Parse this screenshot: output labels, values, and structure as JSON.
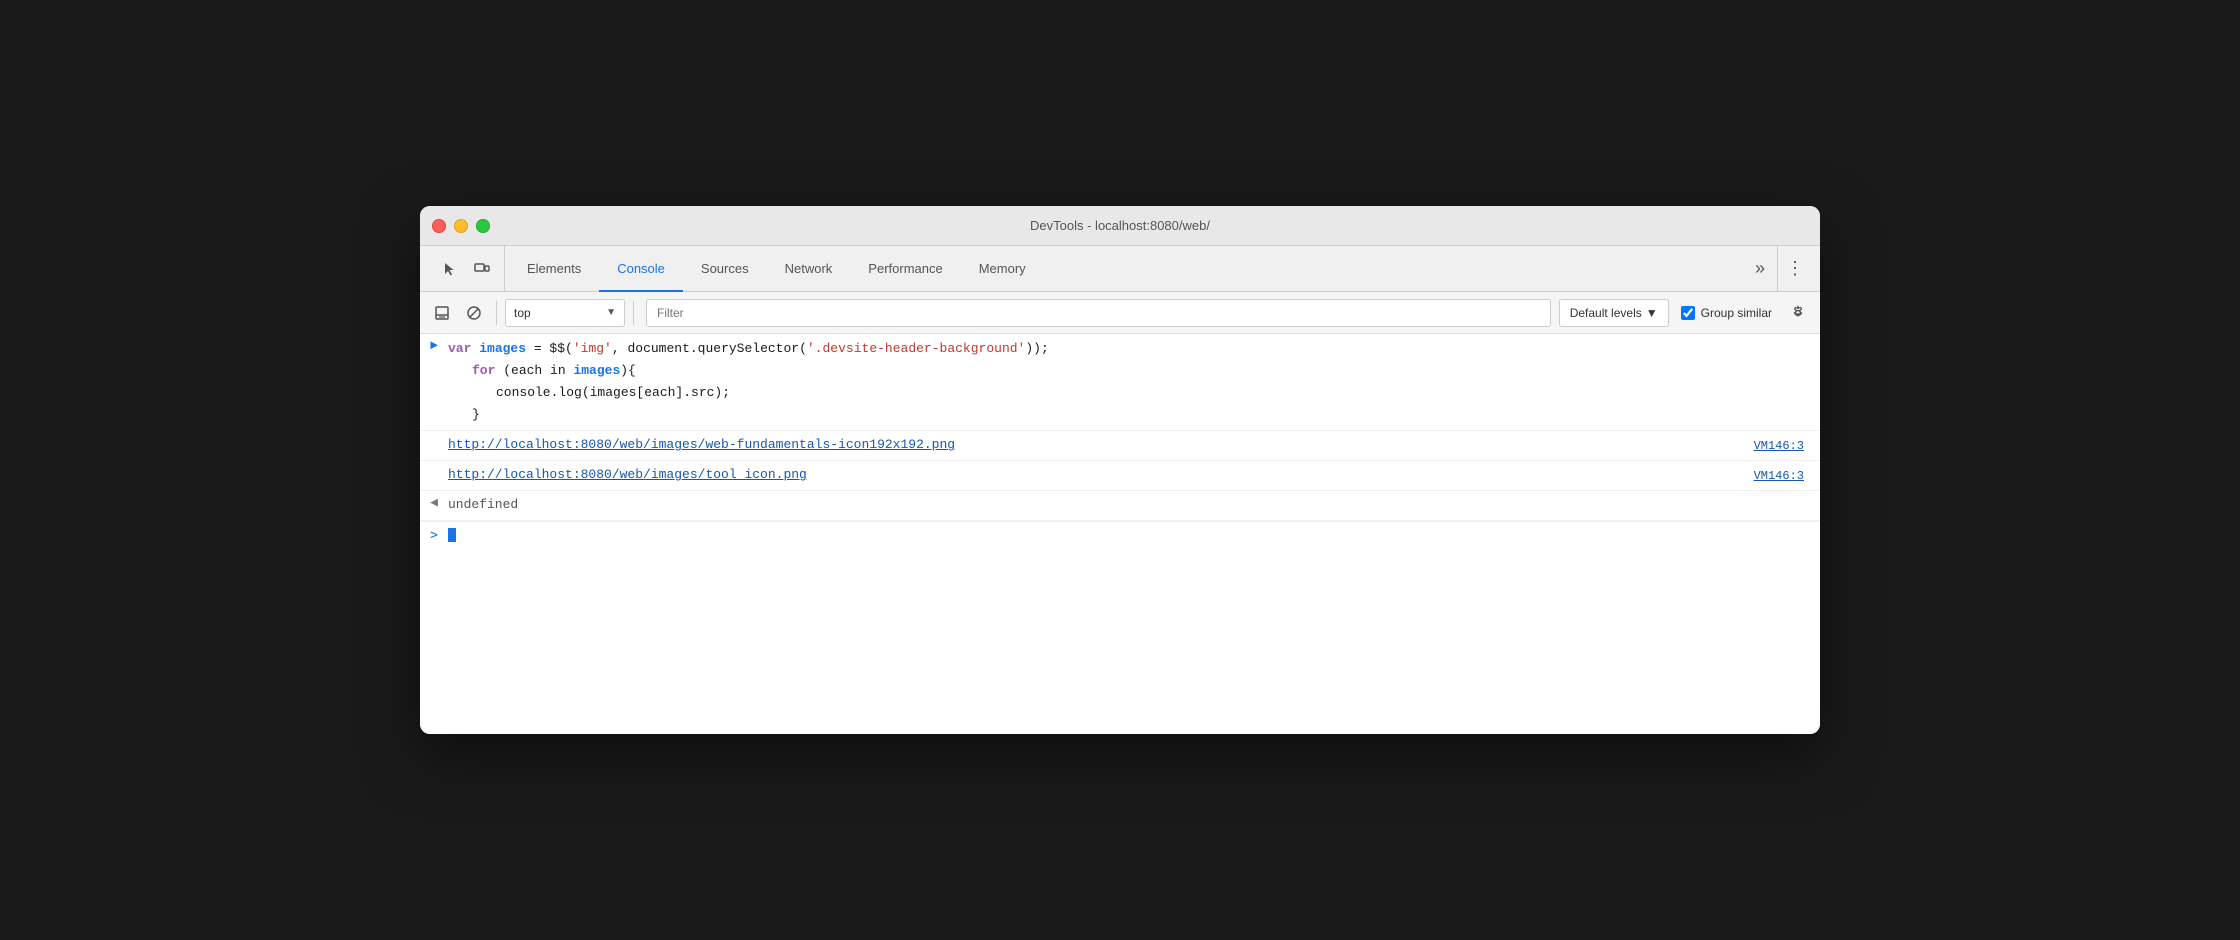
{
  "window": {
    "title": "DevTools - localhost:8080/web/"
  },
  "traffic_lights": {
    "red_label": "close",
    "yellow_label": "minimize",
    "green_label": "maximize"
  },
  "tabs": [
    {
      "id": "elements",
      "label": "Elements",
      "active": false
    },
    {
      "id": "console",
      "label": "Console",
      "active": true
    },
    {
      "id": "sources",
      "label": "Sources",
      "active": false
    },
    {
      "id": "network",
      "label": "Network",
      "active": false
    },
    {
      "id": "performance",
      "label": "Performance",
      "active": false
    },
    {
      "id": "memory",
      "label": "Memory",
      "active": false
    }
  ],
  "toolbar": {
    "context_label": "top",
    "filter_placeholder": "Filter",
    "levels_label": "Default levels",
    "group_similar_label": "Group similar",
    "group_similar_checked": true
  },
  "console": {
    "input_prompt": ">",
    "output_prompt_right": ">",
    "output_prompt_left": "<",
    "entries": [
      {
        "type": "input",
        "prompt": ">",
        "code_lines": [
          {
            "indent": 0,
            "parts": [
              {
                "class": "kw-var",
                "text": "var "
              },
              {
                "class": "var-name",
                "text": "images"
              },
              {
                "class": "plain",
                "text": " = $$("
              },
              {
                "class": "string-red",
                "text": "'img'"
              },
              {
                "class": "plain",
                "text": ", document.querySelector("
              },
              {
                "class": "string-red",
                "text": "'.devsite-header-background'"
              },
              {
                "class": "plain",
                "text": "));"
              }
            ]
          },
          {
            "indent": 1,
            "parts": [
              {
                "class": "kw-for",
                "text": "for "
              },
              {
                "class": "plain",
                "text": "(each in "
              },
              {
                "class": "var-name",
                "text": "images"
              },
              {
                "class": "plain",
                "text": "){"
              }
            ]
          },
          {
            "indent": 2,
            "parts": [
              {
                "class": "plain",
                "text": "console.log(images[each].src);"
              }
            ]
          },
          {
            "indent": 1,
            "parts": [
              {
                "class": "plain",
                "text": "}"
              }
            ]
          }
        ]
      },
      {
        "type": "output-link",
        "prompt": "",
        "url": "http://localhost:8080/web/images/web-fundamentals-icon192x192.png",
        "source": "VM146:3"
      },
      {
        "type": "output-link",
        "prompt": "",
        "url": "http://localhost:8080/web/images/tool_icon.png",
        "source": "VM146:3"
      },
      {
        "type": "output-value",
        "prompt": "<",
        "value": "undefined"
      }
    ]
  }
}
